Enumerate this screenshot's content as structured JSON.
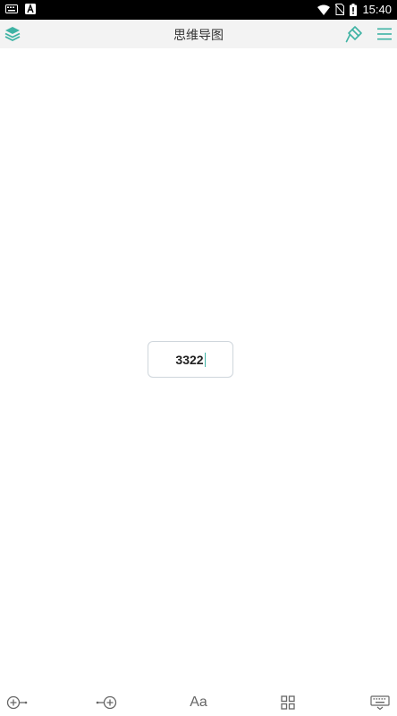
{
  "status_bar": {
    "time": "15:40",
    "icons": [
      "keyboard-notification-icon",
      "a-notification-icon",
      "wifi-icon",
      "no-sim-icon",
      "battery-icon"
    ]
  },
  "toolbar": {
    "title": "思维导图",
    "accent_color": "#3fb3a4"
  },
  "canvas": {
    "node_text": "3322"
  },
  "bottom_bar": {
    "font_label": "Aa",
    "items": [
      "add-child-node-icon",
      "add-sibling-node-icon",
      "font-style-button",
      "layout-grid-icon",
      "keyboard-icon"
    ]
  }
}
